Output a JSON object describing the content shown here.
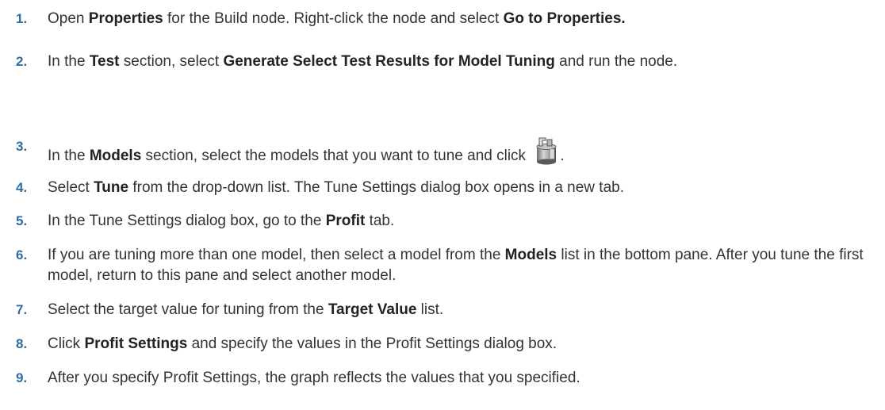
{
  "steps": [
    {
      "num": "1.",
      "parts": [
        "Open ",
        "Properties",
        " for the Build node. Right-click the node and select ",
        "Go to Properties."
      ]
    },
    {
      "num": "2.",
      "parts": [
        "In the ",
        "Test",
        " section, select ",
        "Generate Select Test Results for Model Tuning",
        " and run the node."
      ]
    },
    {
      "num": "3.",
      "parts": [
        "In the ",
        "Models",
        " section, select the models that you want to tune and click ",
        "."
      ]
    },
    {
      "num": "4.",
      "parts": [
        "Select ",
        "Tune",
        " from the drop-down list. The Tune Settings dialog box opens in a new tab."
      ]
    },
    {
      "num": "5.",
      "parts": [
        "In the Tune Settings dialog box, go to the ",
        "Profit",
        " tab."
      ]
    },
    {
      "num": "6.",
      "parts": [
        "If you are tuning more than one model, then select a model from the ",
        "Models",
        " list in the bottom pane. After you tune the first model, return to this pane and select another model."
      ]
    },
    {
      "num": "7.",
      "parts": [
        "Select the target value for tuning from the ",
        "Target Value",
        " list."
      ]
    },
    {
      "num": "8.",
      "parts": [
        "Click ",
        "Profit Settings",
        " and specify the values in the Profit Settings dialog box."
      ]
    },
    {
      "num": "9.",
      "parts": [
        "After you specify Profit Settings, the graph reflects the values that you specified."
      ]
    }
  ],
  "icons": {
    "tune_models": "tune-models-icon"
  },
  "colors": {
    "step_number": "#2e6da4",
    "text": "#333333"
  }
}
